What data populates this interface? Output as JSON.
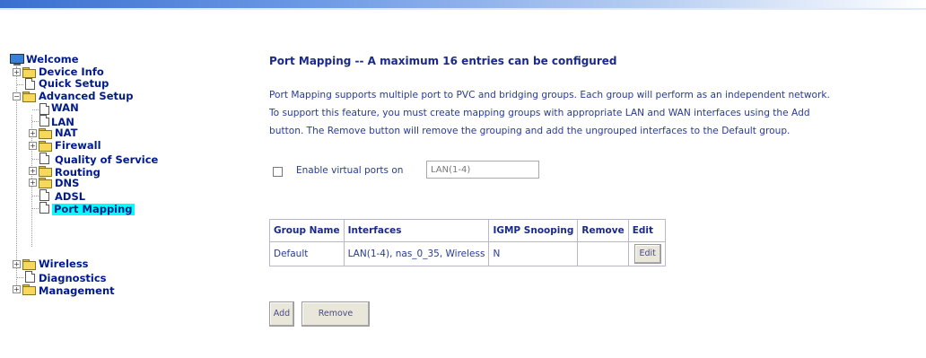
{
  "sidebar": {
    "items": [
      {
        "label": "Welcome",
        "icon": "monitor-icon"
      },
      {
        "label": "Device Info",
        "icon": "folder-icon"
      },
      {
        "label": "Quick Setup",
        "icon": "document-icon"
      },
      {
        "label": "Advanced Setup",
        "icon": "folder-open-icon"
      },
      {
        "label": "WAN",
        "icon": "document-icon"
      },
      {
        "label": "LAN",
        "icon": "document-icon"
      },
      {
        "label": "NAT",
        "icon": "folder-icon"
      },
      {
        "label": "Firewall",
        "icon": "folder-icon"
      },
      {
        "label": "Quality of Service",
        "icon": "document-icon"
      },
      {
        "label": "Routing",
        "icon": "folder-icon"
      },
      {
        "label": "DNS",
        "icon": "folder-icon"
      },
      {
        "label": "ADSL",
        "icon": "document-icon"
      },
      {
        "label": "Port Mapping",
        "icon": "document-icon"
      },
      {
        "label": "Wireless",
        "icon": "folder-icon"
      },
      {
        "label": "Diagnostics",
        "icon": "document-icon"
      },
      {
        "label": "Management",
        "icon": "folder-icon"
      }
    ],
    "selected": "Port Mapping",
    "selected_color": "#00ffff"
  },
  "main": {
    "title": "Port Mapping -- A maximum 16 entries can be configured",
    "description": [
      "Port Mapping supports multiple port to PVC and bridging groups. Each group will perform as an independent network.",
      "To support this feature, you must create mapping groups with appropriate LAN and WAN interfaces using the Add",
      "button. The Remove button will remove the grouping and add the ungrouped interfaces to the Default group."
    ],
    "virtual_ports": {
      "label": "Enable virtual ports on",
      "value": "LAN(1-4)",
      "checked": false
    },
    "table": {
      "headers": [
        "Group Name",
        "Interfaces",
        "IGMP Snooping",
        "Remove",
        "Edit"
      ],
      "rows": [
        {
          "group_name": "Default",
          "interfaces": "LAN(1-4), nas_0_35, Wireless",
          "igmp_snooping": "N",
          "remove": "",
          "edit_label": "Edit"
        }
      ]
    },
    "add_label": "Add",
    "remove_label": "Remove"
  },
  "colors": {
    "text": "#283b96",
    "header_gradient_start": "#3a6fd0"
  }
}
